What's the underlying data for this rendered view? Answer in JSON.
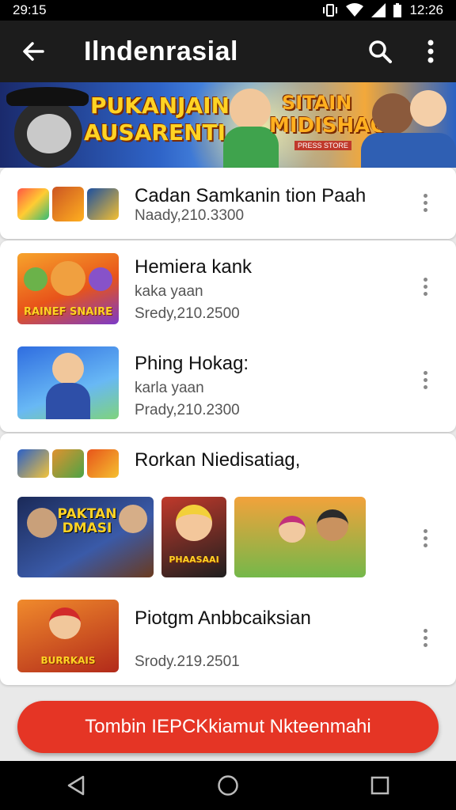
{
  "status_bar": {
    "time": "29:15",
    "clock": "12:26"
  },
  "app_bar": {
    "title": "Ilndenrasial"
  },
  "banner": {
    "left_line1": "PUKANJAIN",
    "left_line2": "AUSARENTI",
    "right_line1": "SITAIN",
    "right_line2": "MIDISHAG",
    "tagline": "PRESS STORE"
  },
  "list": {
    "items": [
      {
        "title": "Cadan Samkanin tion Paah",
        "subtitle": "Naady,210.3300"
      },
      {
        "title": "Hemiera kank",
        "subtitle": "kaka yaan",
        "meta": "Sredy,210.2500",
        "thumb_label": "RAINEF SNAIRE"
      },
      {
        "title": "Phing Hokag:",
        "subtitle": "karla yaan",
        "meta": "Prady,210.2300"
      },
      {
        "title": "Rorkan Niedisatiag,"
      },
      {
        "thumb_a_label": "PAKTAN DMASI",
        "thumb_b_label": "PHAASAAI"
      },
      {
        "title": "Piotgm Anbbcaiksian",
        "meta": "Srody.219.2501",
        "thumb_label": "BURRKAIS"
      }
    ]
  },
  "cta": {
    "label": "Tombin IEPCKkiamut Nkteenmahi"
  },
  "colors": {
    "accent": "#e53525",
    "app_bar": "#1c1c1c"
  }
}
